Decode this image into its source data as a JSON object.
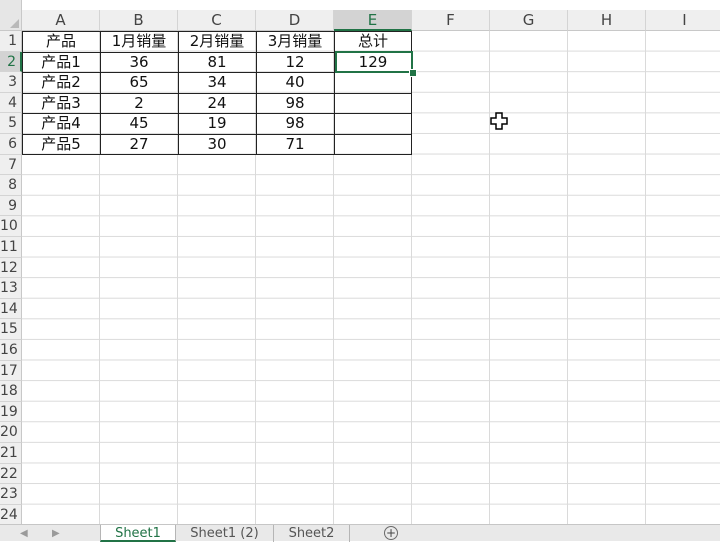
{
  "columns": [
    "A",
    "B",
    "C",
    "D",
    "E",
    "F",
    "G",
    "H",
    "I"
  ],
  "rows": [
    "1",
    "2",
    "3",
    "4",
    "5",
    "6",
    "7",
    "8",
    "9",
    "10",
    "11",
    "12",
    "13",
    "14",
    "15",
    "16",
    "17",
    "18",
    "19",
    "20",
    "21",
    "22",
    "23",
    "24"
  ],
  "table": {
    "headers": [
      "产品",
      "1月销量",
      "2月销量",
      "3月销量",
      "总计"
    ],
    "rows": [
      [
        "产品1",
        "36",
        "81",
        "12",
        "129"
      ],
      [
        "产品2",
        "65",
        "34",
        "40",
        ""
      ],
      [
        "产品3",
        "2",
        "24",
        "98",
        ""
      ],
      [
        "产品4",
        "45",
        "19",
        "98",
        ""
      ],
      [
        "产品5",
        "27",
        "30",
        "71",
        ""
      ]
    ]
  },
  "selection": {
    "cell": "E2",
    "column": "E",
    "row": "2"
  },
  "sheet_tabs": [
    {
      "label": "Sheet1",
      "active": true
    },
    {
      "label": "Sheet1 (2)",
      "active": false
    },
    {
      "label": "Sheet2",
      "active": false
    }
  ],
  "icons": {
    "add_sheet": "plus-circle-icon",
    "cursor": "cross-cursor-icon",
    "nav_prev": "triangle-left-icon",
    "nav_next": "triangle-right-icon"
  },
  "colors": {
    "accent": "#217346",
    "grid": "#dadada",
    "table_border": "#222222"
  }
}
